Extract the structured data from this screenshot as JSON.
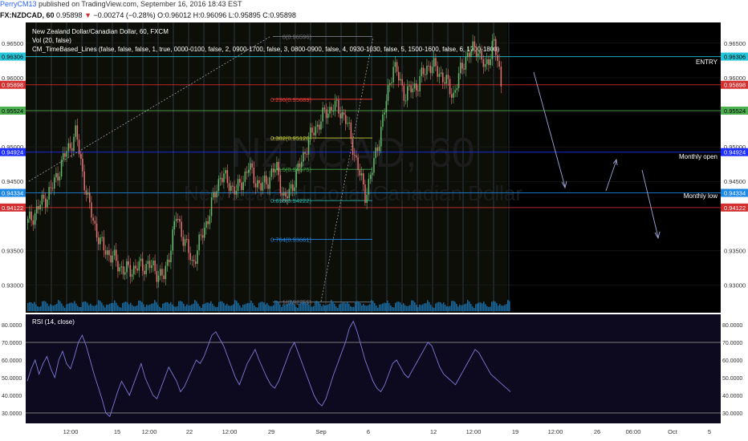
{
  "header": {
    "author": "PerryCM13",
    "published": "published on TradingView.com, September 16, 2016 18:43 EST",
    "symbol": "FX:NZDCAD, 60",
    "last": "0.95898",
    "change_arrow": "▼",
    "change": "−0.00274 (−0.28%)",
    "open": "O:0.96012",
    "high": "H:0.96096",
    "low": "L:0.95895",
    "close": "C:0.95898"
  },
  "legend": {
    "title": "New Zealand Dollar/Canadian Dollar, 60, FXCM",
    "volume": "Vol (20, false)",
    "indicator": "CM_TimeBased_Lines (false, false, false, 1, true, 0000-0100, false, 2, 0900-1700, false, 3, 0800-0900, false, 4, 0930-1030, false, 5, 1500-1600, false, 6, 1700-1800)"
  },
  "watermark": {
    "symbol": "NZDCAD, 60",
    "name": "New Zealand Dollar/Canadian Dollar"
  },
  "annotations": {
    "entry": "ENTRY",
    "monthly_open": "Monthly open",
    "monthly_low": "Monthly low"
  },
  "fib_levels": [
    {
      "label": "0(0.96596)",
      "price": 0.96596,
      "color": "#787b86"
    },
    {
      "label": "0.236(0.95689)",
      "price": 0.95689,
      "color": "#e53935"
    },
    {
      "label": "0.382(0.95128)",
      "price": 0.95128,
      "color": "#c0ca33"
    },
    {
      "label": "0.5(0.94675)",
      "price": 0.94675,
      "color": "#43a047"
    },
    {
      "label": "0.618(0.94222)",
      "price": 0.94222,
      "color": "#26a69a"
    },
    {
      "label": "0.764(0.93661)",
      "price": 0.93661,
      "color": "#1e88e5"
    },
    {
      "label": "1(0.92755)",
      "price": 0.92755,
      "color": "#787b86"
    }
  ],
  "price_tags": [
    {
      "value": "0.96306",
      "price": 0.96306,
      "bg": "#26c6da",
      "fg": "#000000"
    },
    {
      "value": "0.95898",
      "price": 0.95898,
      "bg": "#d32f2f",
      "fg": "#ffffff"
    },
    {
      "value": "0.95524",
      "price": 0.95524,
      "bg": "#4caf50",
      "fg": "#000000"
    },
    {
      "value": "0.94924",
      "price": 0.94924,
      "bg": "#1e2fff",
      "fg": "#ffffff"
    },
    {
      "value": "0.94334",
      "price": 0.94334,
      "bg": "#1e88e5",
      "fg": "#ffffff"
    },
    {
      "value": "0.94122",
      "price": 0.94122,
      "bg": "#d32f2f",
      "fg": "#ffffff"
    }
  ],
  "chart_data": [
    {
      "type": "candlestick",
      "title": "New Zealand Dollar/Canadian Dollar, 60, FXCM",
      "ylim": [
        0.926,
        0.968
      ],
      "y_ticks": [
        "0.96500",
        "0.96000",
        "0.95500",
        "0.95000",
        "0.94500",
        "0.93500",
        "0.93000"
      ],
      "x_ticks": [
        "12:00",
        "15",
        "12:00",
        "22",
        "12:00",
        "29",
        "Sep",
        "6",
        "12",
        "12:00",
        "19",
        "12:00",
        "26",
        "06:00",
        "Oct",
        "5"
      ],
      "horizontal_levels": [
        {
          "name": "ENTRY",
          "price": 0.96306
        },
        {
          "name": "Monthly open",
          "price": 0.94924
        },
        {
          "name": "Monthly low",
          "price": 0.94334
        },
        {
          "price": 0.95524
        },
        {
          "price": 0.94122
        }
      ],
      "price_path": [
        [
          0,
          0.939
        ],
        [
          30,
          0.944
        ],
        [
          45,
          0.9485
        ],
        [
          60,
          0.952
        ],
        [
          65,
          0.9485
        ],
        [
          75,
          0.942
        ],
        [
          90,
          0.936
        ],
        [
          120,
          0.932
        ],
        [
          150,
          0.933
        ],
        [
          170,
          0.931
        ],
        [
          185,
          0.94
        ],
        [
          205,
          0.933
        ],
        [
          225,
          0.94
        ],
        [
          240,
          0.946
        ],
        [
          260,
          0.9435
        ],
        [
          275,
          0.947
        ],
        [
          290,
          0.944
        ],
        [
          310,
          0.947
        ],
        [
          320,
          0.942
        ],
        [
          335,
          0.946
        ],
        [
          350,
          0.951
        ],
        [
          365,
          0.954
        ],
        [
          380,
          0.956
        ],
        [
          395,
          0.9545
        ],
        [
          405,
          0.95
        ],
        [
          420,
          0.943
        ],
        [
          430,
          0.947
        ],
        [
          445,
          0.9555
        ],
        [
          455,
          0.962
        ],
        [
          470,
          0.9575
        ],
        [
          485,
          0.959
        ],
        [
          500,
          0.962
        ],
        [
          515,
          0.9605
        ],
        [
          530,
          0.9575
        ],
        [
          545,
          0.963
        ],
        [
          560,
          0.9645
        ],
        [
          570,
          0.961
        ],
        [
          580,
          0.9655
        ],
        [
          590,
          0.959
        ]
      ],
      "volume_level": "low"
    },
    {
      "type": "line",
      "title": "RSI (14, close)",
      "ylim": [
        25,
        85
      ],
      "y_ticks": [
        "80.0000",
        "70.0000",
        "60.0000",
        "50.0000",
        "40.0000",
        "30.0000"
      ],
      "bands": [
        30,
        70
      ],
      "values": [
        48,
        55,
        60,
        52,
        58,
        62,
        55,
        50,
        60,
        65,
        58,
        55,
        62,
        70,
        74,
        68,
        60,
        52,
        45,
        38,
        30,
        28,
        35,
        42,
        48,
        44,
        40,
        46,
        52,
        58,
        50,
        45,
        40,
        38,
        44,
        50,
        56,
        52,
        48,
        42,
        45,
        50,
        55,
        60,
        58,
        62,
        68,
        74,
        76,
        72,
        68,
        62,
        56,
        50,
        46,
        52,
        58,
        62,
        66,
        60,
        55,
        50,
        46,
        44,
        48,
        54,
        60,
        66,
        70,
        64,
        58,
        52,
        46,
        40,
        36,
        34,
        38,
        45,
        52,
        58,
        64,
        70,
        78,
        82,
        76,
        68,
        60,
        54,
        48,
        44,
        42,
        46,
        52,
        58,
        60,
        56,
        52,
        50,
        54,
        58,
        62,
        66,
        70,
        68,
        62,
        56,
        52,
        50,
        48,
        46,
        50,
        54,
        58,
        62,
        66,
        64,
        60,
        56,
        52,
        50,
        48,
        46,
        44,
        42
      ]
    }
  ],
  "colors": {
    "background": "#000000",
    "candle_up": "#66bb6a",
    "candle_down": "#e57373",
    "rsi_line": "#7e79d9",
    "rsi_background": "#0d0a1f",
    "grid": "#2b2b2b",
    "session_lines": "#4e6b8c"
  }
}
